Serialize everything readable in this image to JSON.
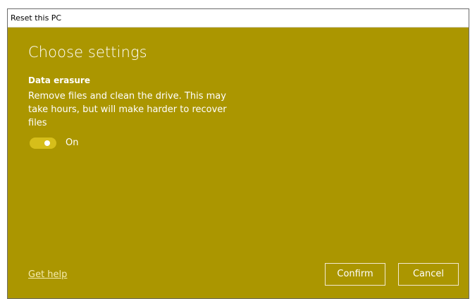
{
  "window": {
    "title": "Reset this PC"
  },
  "dialog": {
    "heading": "Choose settings",
    "section_title": "Data erasure",
    "description": "Remove files and clean the drive. This may take hours, but will make harder to recover files",
    "toggle": {
      "state": "On",
      "checked": true
    },
    "help_link": "Get help",
    "confirm_label": "Confirm",
    "cancel_label": "Cancel"
  },
  "colors": {
    "accent_background": "#ab9600",
    "toggle_fill": "#d6be1a",
    "text": "#ffffff"
  },
  "icons": {
    "toggle_knob": "toggle-knob-icon"
  }
}
